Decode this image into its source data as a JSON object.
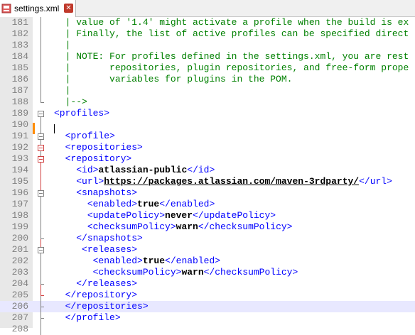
{
  "tab": {
    "title": "settings.xml",
    "close_glyph": "✕",
    "icon": "xml-file-icon"
  },
  "lines": [
    {
      "num": "181",
      "text": "  | value of '1.4' might activate a profile when the build is ex"
    },
    {
      "num": "182",
      "text": "  | Finally, the list of active profiles can be specified direct"
    },
    {
      "num": "183",
      "text": "  |"
    },
    {
      "num": "184",
      "text": "  | NOTE: For profiles defined in the settings.xml, you are rest"
    },
    {
      "num": "185",
      "text": "  |       repositories, plugin repositories, and free-form prope"
    },
    {
      "num": "186",
      "text": "  |       variables for plugins in the POM."
    },
    {
      "num": "187",
      "text": "  |"
    },
    {
      "num": "188",
      "text": "  |-->"
    },
    {
      "num": "189",
      "text": "<profiles>"
    },
    {
      "num": "190",
      "text": ""
    },
    {
      "num": "191",
      "text": "  <profile>"
    },
    {
      "num": "192",
      "text": "  <repositories>"
    },
    {
      "num": "193",
      "text": "  <repository>"
    },
    {
      "num": "194",
      "text": "    <id>atlassian-public</id>"
    },
    {
      "num": "195",
      "text": "    <url>https://packages.atlassian.com/maven-3rdparty/</url>"
    },
    {
      "num": "196",
      "text": "    <snapshots>"
    },
    {
      "num": "197",
      "text": "      <enabled>true</enabled>"
    },
    {
      "num": "198",
      "text": "      <updatePolicy>never</updatePolicy>"
    },
    {
      "num": "199",
      "text": "      <checksumPolicy>warn</checksumPolicy>"
    },
    {
      "num": "200",
      "text": "    </snapshots>"
    },
    {
      "num": "201",
      "text": "     <releases>"
    },
    {
      "num": "202",
      "text": "       <enabled>true</enabled>"
    },
    {
      "num": "203",
      "text": "       <checksumPolicy>warn</checksumPolicy>"
    },
    {
      "num": "204",
      "text": "    </releases>"
    },
    {
      "num": "205",
      "text": "  </repository>"
    },
    {
      "num": "206",
      "text": "  </repositories>"
    },
    {
      "num": "207",
      "text": "  </profile>"
    },
    {
      "num": "208",
      "text": ""
    }
  ],
  "highlighted_line": "206",
  "colors": {
    "tag": "#0000ff",
    "comment": "#008000",
    "value": "#000000",
    "line_highlight": "#e8e8ff",
    "change_marker": "#ff8c00",
    "fold_red": "#d04040"
  }
}
